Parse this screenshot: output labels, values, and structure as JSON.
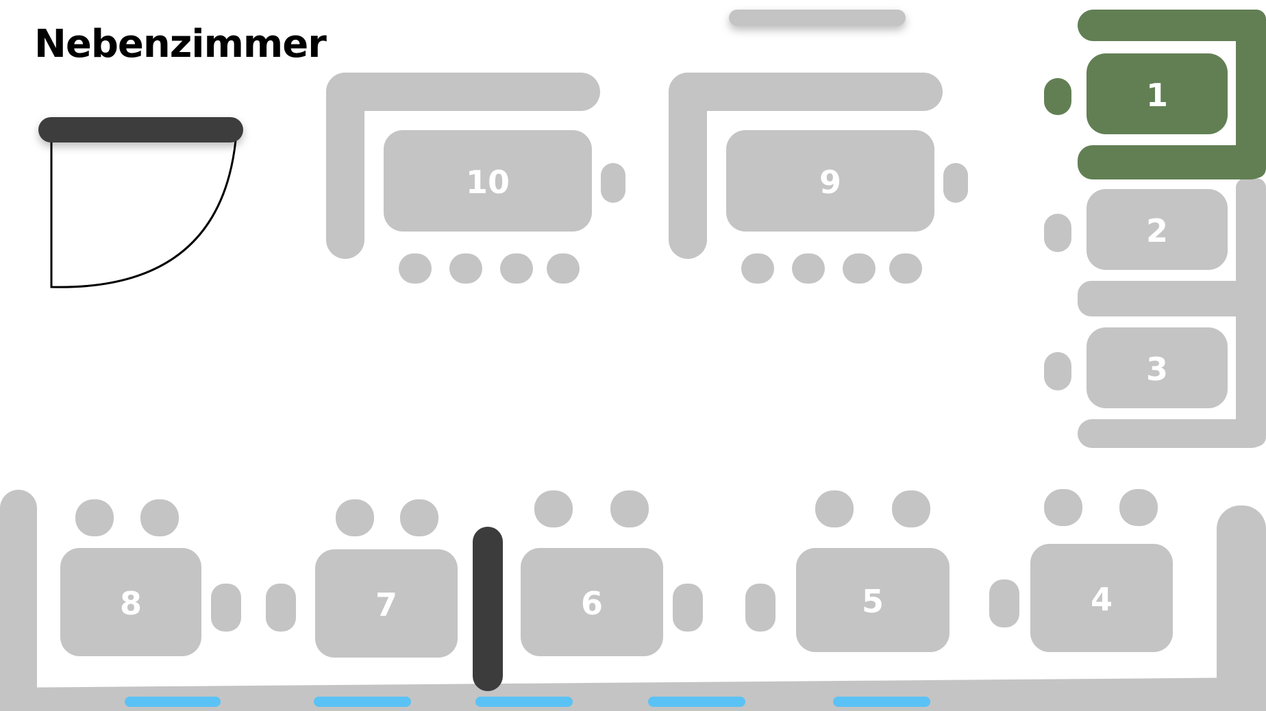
{
  "room": {
    "title": "Nebenzimmer"
  },
  "colors": {
    "furniture": "#c4c4c4",
    "selected": "#627f54",
    "wall_dark": "#3c3c3c",
    "window": "#5bc2f5",
    "label": "#ffffff"
  },
  "tables": [
    {
      "number": "1",
      "selected": true
    },
    {
      "number": "2",
      "selected": false
    },
    {
      "number": "3",
      "selected": false
    },
    {
      "number": "4",
      "selected": false
    },
    {
      "number": "5",
      "selected": false
    },
    {
      "number": "6",
      "selected": false
    },
    {
      "number": "7",
      "selected": false
    },
    {
      "number": "8",
      "selected": false
    },
    {
      "number": "9",
      "selected": false
    },
    {
      "number": "10",
      "selected": false
    }
  ]
}
